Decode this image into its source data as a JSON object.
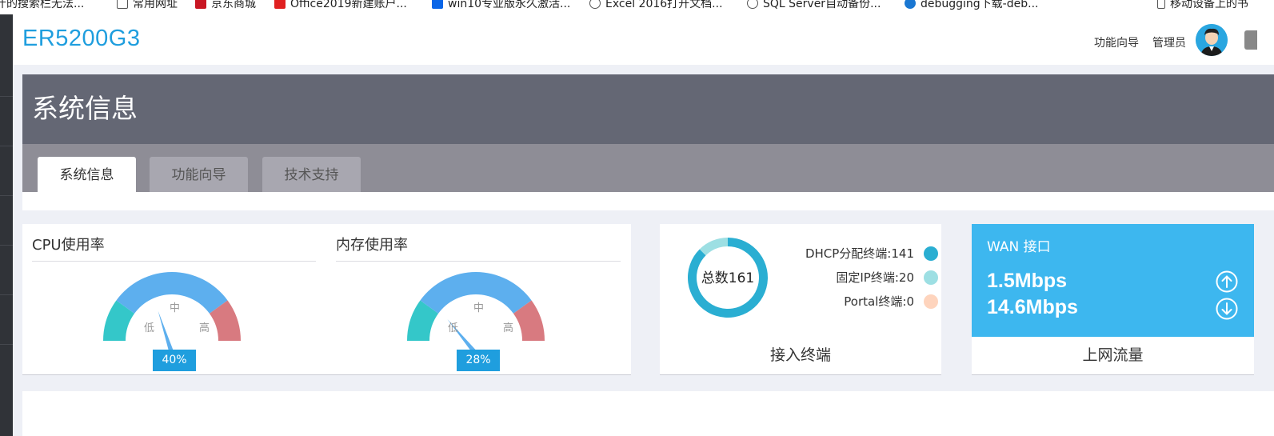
{
  "bookmarks": [
    {
      "label": "什的搜索栏无法...",
      "icon": "page-icon",
      "color": "#ffffff"
    },
    {
      "label": "常用网址",
      "icon": "folder-icon",
      "color": "#ffffff"
    },
    {
      "label": "京东商城",
      "icon": "jd-icon",
      "color": "#c81623"
    },
    {
      "label": "Office2019新建账户...",
      "icon": "e-icon",
      "color": "#e02020"
    },
    {
      "label": "win10专业版永久激活...",
      "icon": "zhihu-icon",
      "color": "#0a66e8"
    },
    {
      "label": "Excel 2016打开文档...",
      "icon": "link-icon",
      "color": "#ffffff"
    },
    {
      "label": "SQL Server自动备份...",
      "icon": "globe-icon",
      "color": "#ffffff"
    },
    {
      "label": "debugging下载-deb...",
      "icon": "edge-icon",
      "color": "#1a77d2"
    },
    {
      "label": "移动设备上的书",
      "icon": "phone-icon",
      "color": "#ffffff"
    }
  ],
  "header": {
    "logo": "ER5200G3",
    "wizard_link": "功能向导",
    "admin_link": "管理员",
    "avatar_icon": "user-avatar-icon",
    "settings_icon": "gear-icon"
  },
  "page": {
    "title": "系统信息",
    "tabs": [
      {
        "label": "系统信息",
        "active": true
      },
      {
        "label": "功能向导",
        "active": false
      },
      {
        "label": "技术支持",
        "active": false
      }
    ]
  },
  "cpu": {
    "title": "CPU使用率",
    "value": 40,
    "value_label": "40%",
    "low_label": "低",
    "mid_label": "中",
    "high_label": "高"
  },
  "memory": {
    "title": "内存使用率",
    "value": 28,
    "value_label": "28%",
    "low_label": "低",
    "mid_label": "中",
    "high_label": "高"
  },
  "gauge_colors": {
    "low": "#34c7c9",
    "mid": "#5dafee",
    "high": "#d87a80",
    "needle": "#5dafee"
  },
  "terminals": {
    "center_text": "总数161",
    "footer": "接入终端",
    "total": 161,
    "items": [
      {
        "label": "DHCP分配终端:141",
        "value": 141,
        "color": "#2aaed2"
      },
      {
        "label": "固定IP终端:20",
        "value": 20,
        "color": "#9ddfe3"
      },
      {
        "label": "Portal终端:0",
        "value": 0,
        "color": "#fed4bd"
      }
    ]
  },
  "wan": {
    "title": "WAN 接口",
    "up": "1.5Mbps",
    "down": "14.6Mbps",
    "up_icon": "arrow-up-circle-icon",
    "down_icon": "arrow-down-circle-icon",
    "footer": "上网流量",
    "color": "#3db7ef"
  }
}
